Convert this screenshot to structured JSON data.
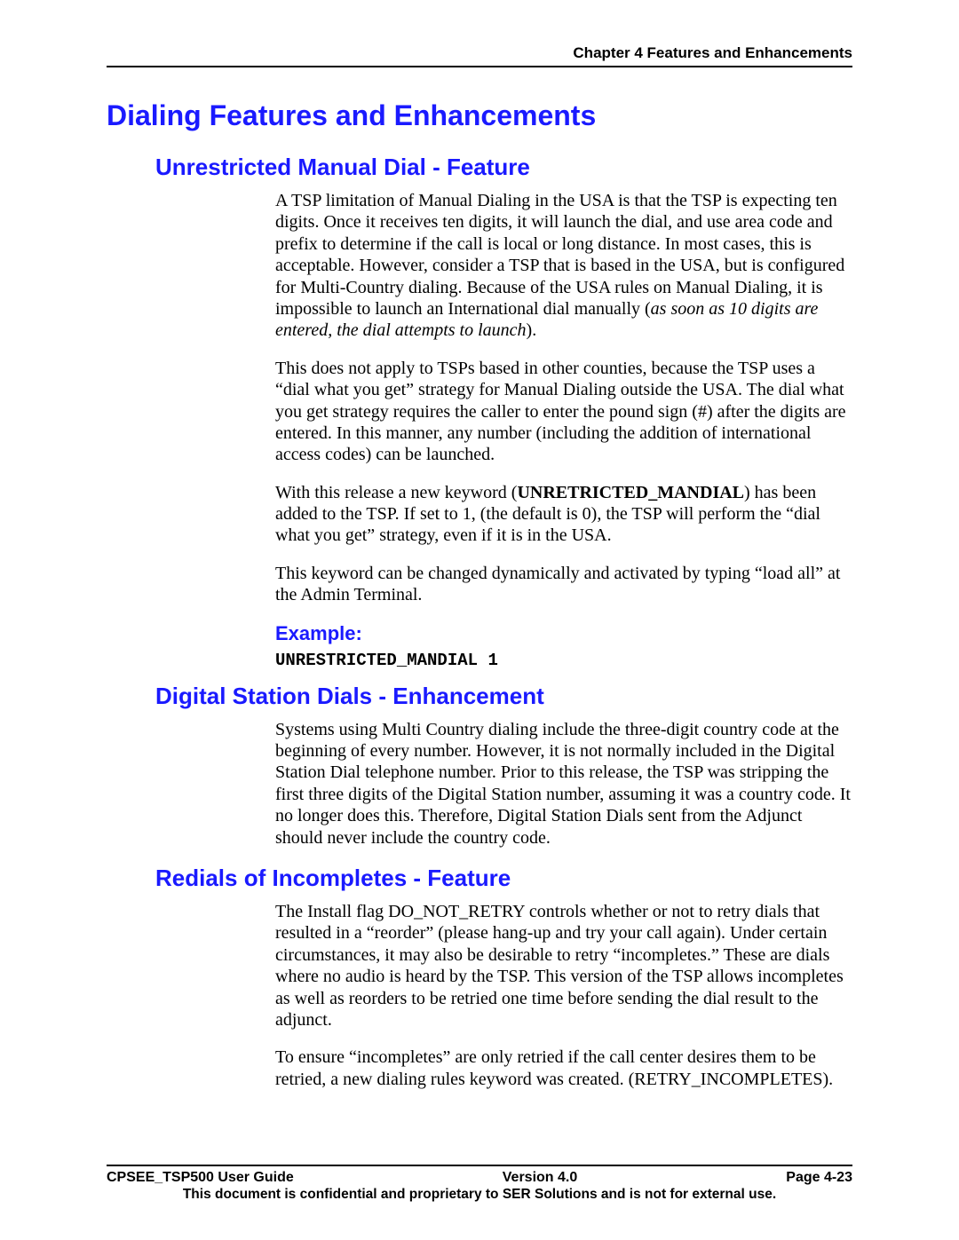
{
  "header": {
    "running": "Chapter 4 Features and Enhancements"
  },
  "h1": "Dialing Features and Enhancements",
  "sections": {
    "s1": {
      "title": "Unrestricted Manual Dial - Feature",
      "p1_a": "A TSP limitation of Manual Dialing in the USA is that the TSP is expecting ten digits. Once it receives ten digits, it will launch the dial, and use area code and prefix to determine if the call is local or long distance.  In most cases, this is acceptable. However, consider a TSP that is based in the USA, but is configured for Multi-Country dialing. Because of the USA rules on Manual Dialing, it is impossible to launch an International dial manually (",
      "p1_i": "as soon as 10 digits are entered, the dial attempts to launch",
      "p1_b": ").",
      "p2": "This does not apply to TSPs based in other counties, because the TSP uses a “dial what you get” strategy for Manual Dialing outside the USA. The dial what you get strategy requires the caller to enter the pound sign (#) after the digits are entered. In this manner, any number (including the addition of international access codes) can be launched.",
      "p3_a": "With this release a new keyword (",
      "p3_kw": "UNRETRICTED_MANDIAL",
      "p3_b": ") has been added to the TSP.  If set to 1, (the default is 0), the TSP will perform the “dial what you get” strategy, even if it is in the USA.",
      "p4": "This keyword can be changed dynamically and activated by typing “load all” at the Admin Terminal.",
      "example_label": "Example:",
      "example_code": "UNRESTRICTED_MANDIAL 1"
    },
    "s2": {
      "title": "Digital Station Dials - Enhancement",
      "p1": "Systems using Multi Country dialing include the three-digit country code at the beginning of every number. However, it is not normally included in the Digital Station Dial telephone number. Prior to this release, the TSP was stripping the first three digits of the Digital Station number, assuming it was a country code.  It no longer does this. Therefore, Digital Station Dials sent from the Adjunct should never include the country code."
    },
    "s3": {
      "title": "Redials of Incompletes - Feature",
      "p1": "The Install flag DO_NOT_RETRY controls whether or not to retry dials that resulted in a “reorder” (please hang-up and try your call again). Under certain circumstances, it may also be desirable to retry “incompletes.”  These are dials where no audio is heard by the TSP. This version of the TSP allows incompletes as well as reorders to be retried one time before sending the dial result to the adjunct.",
      "p2": "To ensure “incompletes” are only retried if the call center desires them to be retried, a new dialing rules keyword was created. (RETRY_INCOMPLETES)."
    }
  },
  "footer": {
    "left": "CPSEE_TSP500 User Guide",
    "center": "Version 4.0",
    "right": "Page 4-23",
    "note": "This document is confidential and proprietary to SER Solutions and is not for external use."
  }
}
